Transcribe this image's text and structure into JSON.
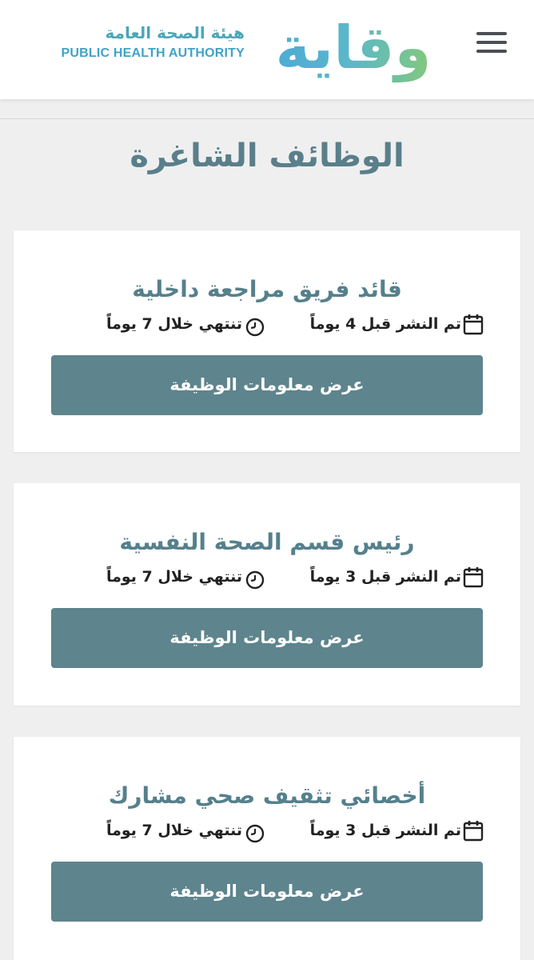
{
  "header": {
    "logo_word": "وقاية",
    "logo_sub_ar": "هيئة الصحة العامة",
    "logo_sub_en": "PUBLIC HEALTH AUTHORITY",
    "menu_icon": "hamburger-menu-icon"
  },
  "page": {
    "title": "الوظائف الشاغرة"
  },
  "jobs": [
    {
      "title": "قائد فريق مراجعة داخلية",
      "posted": "تم النشر قبل 4 يوماً",
      "expires": "تنتهي خلال 7 يوماً",
      "button": "عرض معلومات الوظيفة"
    },
    {
      "title": "رئيس قسم الصحة النفسية",
      "posted": "تم النشر قبل 3 يوماً",
      "expires": "تنتهي خلال 7 يوماً",
      "button": "عرض معلومات الوظيفة"
    },
    {
      "title": "أخصائي تثقيف صحي مشارك",
      "posted": "تم النشر قبل 3 يوماً",
      "expires": "تنتهي خلال 7 يوماً",
      "button": "عرض معلومات الوظيفة"
    }
  ],
  "colors": {
    "accent": "#5e848d",
    "title": "#5a7f8a",
    "background": "#efeff0"
  }
}
